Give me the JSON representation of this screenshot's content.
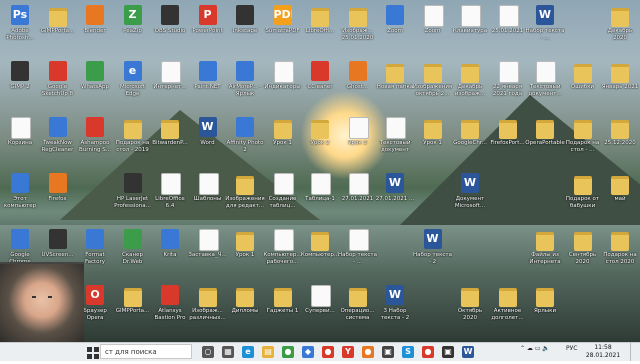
{
  "desktop": {
    "icons": [
      {
        "label": "Adobe Photosh...",
        "glyph": "Ps",
        "kind": "app",
        "col": 0,
        "row": 0
      },
      {
        "label": "GIMPPorta...",
        "glyph": "",
        "kind": "folder",
        "col": 1,
        "row": 0
      },
      {
        "label": "Blender",
        "glyph": "",
        "kind": "orange",
        "col": 2,
        "row": 0
      },
      {
        "label": "PeaZip",
        "glyph": "Z",
        "kind": "green",
        "col": 3,
        "row": 0
      },
      {
        "label": "OBS Studio",
        "glyph": "",
        "kind": "dark",
        "col": 4,
        "row": 0
      },
      {
        "label": "PowerPoint",
        "glyph": "P",
        "kind": "red",
        "col": 5,
        "row": 0
      },
      {
        "label": "Inkscape",
        "glyph": "",
        "kind": "dark",
        "col": 6,
        "row": 0
      },
      {
        "label": "SumatraPDF",
        "glyph": "PDF",
        "kind": "pdf",
        "col": 7,
        "row": 0
      },
      {
        "label": "LibreOffi...",
        "glyph": "",
        "kind": "folder",
        "col": 8,
        "row": 0
      },
      {
        "label": "Изображ... 25.01.2020",
        "glyph": "",
        "kind": "folder",
        "col": 9,
        "row": 0
      },
      {
        "label": "Zoom",
        "glyph": "",
        "kind": "app",
        "col": 10,
        "row": 0
      },
      {
        "label": "Zoom",
        "glyph": "",
        "kind": "doc",
        "col": 11,
        "row": 0
      },
      {
        "label": "Клавиатура",
        "glyph": "",
        "kind": "doc",
        "col": 12,
        "row": 0
      },
      {
        "label": "25.01.2021",
        "glyph": "",
        "kind": "doc",
        "col": 13,
        "row": 0
      },
      {
        "label": "Набор текста - ...",
        "glyph": "W",
        "kind": "word",
        "col": 14,
        "row": 0
      },
      {
        "label": "Декабрь 2020",
        "glyph": "",
        "kind": "folder",
        "col": 16,
        "row": 0
      },
      {
        "label": "GIMP 2",
        "glyph": "",
        "kind": "dark",
        "col": 0,
        "row": 1
      },
      {
        "label": "Google SketchUp 8",
        "glyph": "",
        "kind": "red",
        "col": 1,
        "row": 1
      },
      {
        "label": "WhatsApp",
        "glyph": "",
        "kind": "green",
        "col": 2,
        "row": 1
      },
      {
        "label": "Microsoft Edge",
        "glyph": "e",
        "kind": "app",
        "col": 3,
        "row": 1
      },
      {
        "label": "Интернет...",
        "glyph": "",
        "kind": "doc",
        "col": 4,
        "row": 1
      },
      {
        "label": "Paint.NET",
        "glyph": "",
        "kind": "app",
        "col": 5,
        "row": 1
      },
      {
        "label": "AirMoreP... - Ярлык",
        "glyph": "",
        "kind": "app",
        "col": 6,
        "row": 1
      },
      {
        "label": "Индикаторы",
        "glyph": "",
        "kind": "doc",
        "col": 7,
        "row": 1
      },
      {
        "label": "CCleaner",
        "glyph": "",
        "kind": "red",
        "col": 8,
        "row": 1
      },
      {
        "label": "Ghost...",
        "glyph": "",
        "kind": "orange",
        "col": 9,
        "row": 1
      },
      {
        "label": "Новая папка",
        "glyph": "",
        "kind": "folder",
        "col": 10,
        "row": 1
      },
      {
        "label": "Изображения октябрь 2...",
        "glyph": "",
        "kind": "folder",
        "col": 11,
        "row": 1
      },
      {
        "label": "Декабрь изображ...",
        "glyph": "",
        "kind": "folder",
        "col": 12,
        "row": 1
      },
      {
        "label": "22 января 2021 года",
        "glyph": "",
        "kind": "doc",
        "col": 13,
        "row": 1
      },
      {
        "label": "Текстовый документ...",
        "glyph": "",
        "kind": "doc",
        "col": 14,
        "row": 1
      },
      {
        "label": "Ошибки",
        "glyph": "",
        "kind": "folder",
        "col": 15,
        "row": 1
      },
      {
        "label": "Январь 2021",
        "glyph": "",
        "kind": "folder",
        "col": 16,
        "row": 1
      },
      {
        "label": "Корзина",
        "glyph": "",
        "kind": "doc",
        "col": 0,
        "row": 2
      },
      {
        "label": "TweakNow RegCleaner",
        "glyph": "",
        "kind": "app",
        "col": 1,
        "row": 2
      },
      {
        "label": "Ashampoo Burning S...",
        "glyph": "",
        "kind": "red",
        "col": 2,
        "row": 2
      },
      {
        "label": "Подарок на стол - 2019",
        "glyph": "",
        "kind": "folder",
        "col": 3,
        "row": 2
      },
      {
        "label": "BitwardenP...",
        "glyph": "",
        "kind": "folder",
        "col": 4,
        "row": 2
      },
      {
        "label": "Word",
        "glyph": "W",
        "kind": "word",
        "col": 5,
        "row": 2
      },
      {
        "label": "Affinity Photo 2",
        "glyph": "",
        "kind": "app",
        "col": 6,
        "row": 2
      },
      {
        "label": "Урок 1",
        "glyph": "",
        "kind": "folder",
        "col": 7,
        "row": 2
      },
      {
        "label": "Урок 2",
        "glyph": "",
        "kind": "folder",
        "col": 8,
        "row": 2
      },
      {
        "label": "Урок 3",
        "glyph": "",
        "kind": "doc",
        "col": 9,
        "row": 2
      },
      {
        "label": "Текстовый документ",
        "glyph": "",
        "kind": "doc",
        "col": 10,
        "row": 2
      },
      {
        "label": "Урок 1",
        "glyph": "",
        "kind": "folder",
        "col": 11,
        "row": 2
      },
      {
        "label": "GoogleChr...",
        "glyph": "",
        "kind": "folder",
        "col": 12,
        "row": 2
      },
      {
        "label": "FirefoxPort...",
        "glyph": "",
        "kind": "folder",
        "col": 13,
        "row": 2
      },
      {
        "label": "OperaPortable",
        "glyph": "",
        "kind": "folder",
        "col": 14,
        "row": 2
      },
      {
        "label": "Подарок на стол - ...",
        "glyph": "",
        "kind": "folder",
        "col": 15,
        "row": 2
      },
      {
        "label": "25.12.2020",
        "glyph": "",
        "kind": "folder",
        "col": 16,
        "row": 2
      },
      {
        "label": "Этот компьютер",
        "glyph": "",
        "kind": "app",
        "col": 0,
        "row": 3
      },
      {
        "label": "Firefox",
        "glyph": "",
        "kind": "orange",
        "col": 1,
        "row": 3
      },
      {
        "label": "HP LaserJet Professiona...",
        "glyph": "",
        "kind": "dark",
        "col": 3,
        "row": 3
      },
      {
        "label": "LibreOffice 6.4",
        "glyph": "",
        "kind": "doc",
        "col": 4,
        "row": 3
      },
      {
        "label": "Шаблоны",
        "glyph": "",
        "kind": "doc",
        "col": 5,
        "row": 3
      },
      {
        "label": "Изображения для редакт...",
        "glyph": "",
        "kind": "folder",
        "col": 6,
        "row": 3
      },
      {
        "label": "Создание таблиц...",
        "glyph": "",
        "kind": "doc",
        "col": 7,
        "row": 3
      },
      {
        "label": "Таблица-1",
        "glyph": "",
        "kind": "doc",
        "col": 8,
        "row": 3
      },
      {
        "label": "27.01.2021",
        "glyph": "",
        "kind": "doc",
        "col": 9,
        "row": 3
      },
      {
        "label": "27.01.2021 ...",
        "glyph": "W",
        "kind": "word",
        "col": 10,
        "row": 3
      },
      {
        "label": "Документ Microsoft...",
        "glyph": "W",
        "kind": "word",
        "col": 12,
        "row": 3
      },
      {
        "label": "Подарок от бабушки",
        "glyph": "",
        "kind": "folder",
        "col": 15,
        "row": 3
      },
      {
        "label": "май",
        "glyph": "",
        "kind": "folder",
        "col": 16,
        "row": 3
      },
      {
        "label": "Google Chrome",
        "glyph": "",
        "kind": "app",
        "col": 0,
        "row": 4
      },
      {
        "label": "UVScreen...",
        "glyph": "",
        "kind": "dark",
        "col": 1,
        "row": 4
      },
      {
        "label": "Format Factory",
        "glyph": "",
        "kind": "app",
        "col": 2,
        "row": 4
      },
      {
        "label": "Сканер Dr.Web",
        "glyph": "",
        "kind": "green",
        "col": 3,
        "row": 4
      },
      {
        "label": "Krita",
        "glyph": "",
        "kind": "app",
        "col": 4,
        "row": 4
      },
      {
        "label": "Заставка_Ч...",
        "glyph": "",
        "kind": "doc",
        "col": 5,
        "row": 4
      },
      {
        "label": "Урок 1",
        "glyph": "",
        "kind": "folder",
        "col": 6,
        "row": 4
      },
      {
        "label": "Компьютер... рабочего...",
        "glyph": "",
        "kind": "doc",
        "col": 7,
        "row": 4
      },
      {
        "label": "Компьютер...",
        "glyph": "",
        "kind": "folder",
        "col": 8,
        "row": 4
      },
      {
        "label": "Набор текста - ...",
        "glyph": "",
        "kind": "doc",
        "col": 9,
        "row": 4
      },
      {
        "label": "Набор текста - 2",
        "glyph": "W",
        "kind": "word",
        "col": 11,
        "row": 4
      },
      {
        "label": "Файлы из Интернета",
        "glyph": "",
        "kind": "folder",
        "col": 14,
        "row": 4
      },
      {
        "label": "Сентябрь 2020",
        "glyph": "",
        "kind": "folder",
        "col": 15,
        "row": 4
      },
      {
        "label": "Подарок на стол 2020",
        "glyph": "",
        "kind": "folder",
        "col": 16,
        "row": 4
      },
      {
        "label": "Браузер Opera",
        "glyph": "O",
        "kind": "red",
        "col": 2,
        "row": 5
      },
      {
        "label": "GIMPPorta...",
        "glyph": "",
        "kind": "folder",
        "col": 3,
        "row": 5
      },
      {
        "label": "Atlansys Bastion Pro",
        "glyph": "",
        "kind": "red",
        "col": 4,
        "row": 5
      },
      {
        "label": "Изображ... различных...",
        "glyph": "",
        "kind": "folder",
        "col": 5,
        "row": 5
      },
      {
        "label": "Дипломы",
        "glyph": "",
        "kind": "folder",
        "col": 6,
        "row": 5
      },
      {
        "label": "Гаджеты 1",
        "glyph": "",
        "kind": "folder",
        "col": 7,
        "row": 5
      },
      {
        "label": "Суперви...",
        "glyph": "",
        "kind": "doc",
        "col": 8,
        "row": 5
      },
      {
        "label": "Операцио... система",
        "glyph": "",
        "kind": "folder",
        "col": 9,
        "row": 5
      },
      {
        "label": "3 Набор текста - 2",
        "glyph": "W",
        "kind": "word",
        "col": 10,
        "row": 5
      },
      {
        "label": "Октябрь 2020",
        "glyph": "",
        "kind": "folder",
        "col": 12,
        "row": 5
      },
      {
        "label": "Активное долголет...",
        "glyph": "",
        "kind": "folder",
        "col": 13,
        "row": 5
      },
      {
        "label": "Ярлыки",
        "glyph": "",
        "kind": "folder",
        "col": 14,
        "row": 5
      }
    ]
  },
  "taskbar": {
    "search_placeholder": "ст для поиска",
    "pinned": [
      {
        "glyph": "○",
        "name": "cortana-icon",
        "color": "#555"
      },
      {
        "glyph": "▦",
        "name": "task-view-icon",
        "color": "#555"
      },
      {
        "glyph": "e",
        "name": "edge-icon",
        "color": "#1e90d6"
      },
      {
        "glyph": "▤",
        "name": "file-explorer-icon",
        "color": "#e8b23a"
      },
      {
        "glyph": "●",
        "name": "chrome-icon",
        "color": "#3a9c45"
      },
      {
        "glyph": "◆",
        "name": "yandex-icon",
        "color": "#3a78d6"
      },
      {
        "glyph": "●",
        "name": "opera-icon",
        "color": "#d8392b"
      },
      {
        "glyph": "Y",
        "name": "yandex-browser-icon",
        "color": "#d8392b"
      },
      {
        "glyph": "●",
        "name": "firefox-icon",
        "color": "#e87722"
      },
      {
        "glyph": "▣",
        "name": "app-icon",
        "color": "#444"
      },
      {
        "glyph": "S",
        "name": "skype-icon",
        "color": "#1e90d6"
      },
      {
        "glyph": "●",
        "name": "record-icon",
        "color": "#d8392b"
      },
      {
        "glyph": "▣",
        "name": "app2-icon",
        "color": "#333"
      },
      {
        "glyph": "W",
        "name": "word-icon",
        "color": "#2b579a"
      }
    ],
    "tray_language": "РУС",
    "time": "11:58",
    "date": "28.01.2021"
  }
}
